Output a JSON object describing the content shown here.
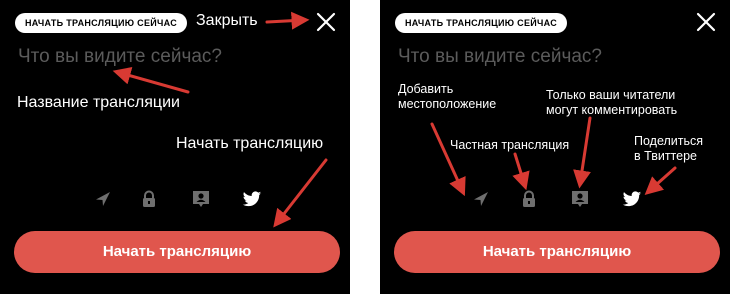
{
  "left_panel": {
    "pill_label": "НАЧАТЬ ТРАНСЛЯЦИЮ СЕЙЧАС",
    "prompt_placeholder": "Что вы видите сейчас?",
    "start_button_label": "Начать трансляцию",
    "annotations": {
      "close": "Закрыть",
      "title": "Название трансляции",
      "start": "Начать трансляцию"
    }
  },
  "right_panel": {
    "pill_label": "НАЧАТЬ ТРАНСЛЯЦИЮ СЕЙЧАС",
    "prompt_placeholder": "Что вы видите сейчас?",
    "start_button_label": "Начать трансляцию",
    "annotations": {
      "location": "Добавить\nместоположение",
      "private": "Частная трансляция",
      "followers": "Только ваши читатели\nмогут комментировать",
      "twitter": "Поделиться\nв Твиттере"
    }
  },
  "icons": [
    "location-arrow-icon",
    "lock-icon",
    "user-bubble-icon",
    "twitter-bird-icon",
    "close-x-icon"
  ],
  "colors": {
    "background": "#000000",
    "accent_button": "#e0564d",
    "annotation_arrow": "#d83a33",
    "placeholder_text": "#5b5b5b",
    "muted_icon": "#6f6f6f"
  }
}
